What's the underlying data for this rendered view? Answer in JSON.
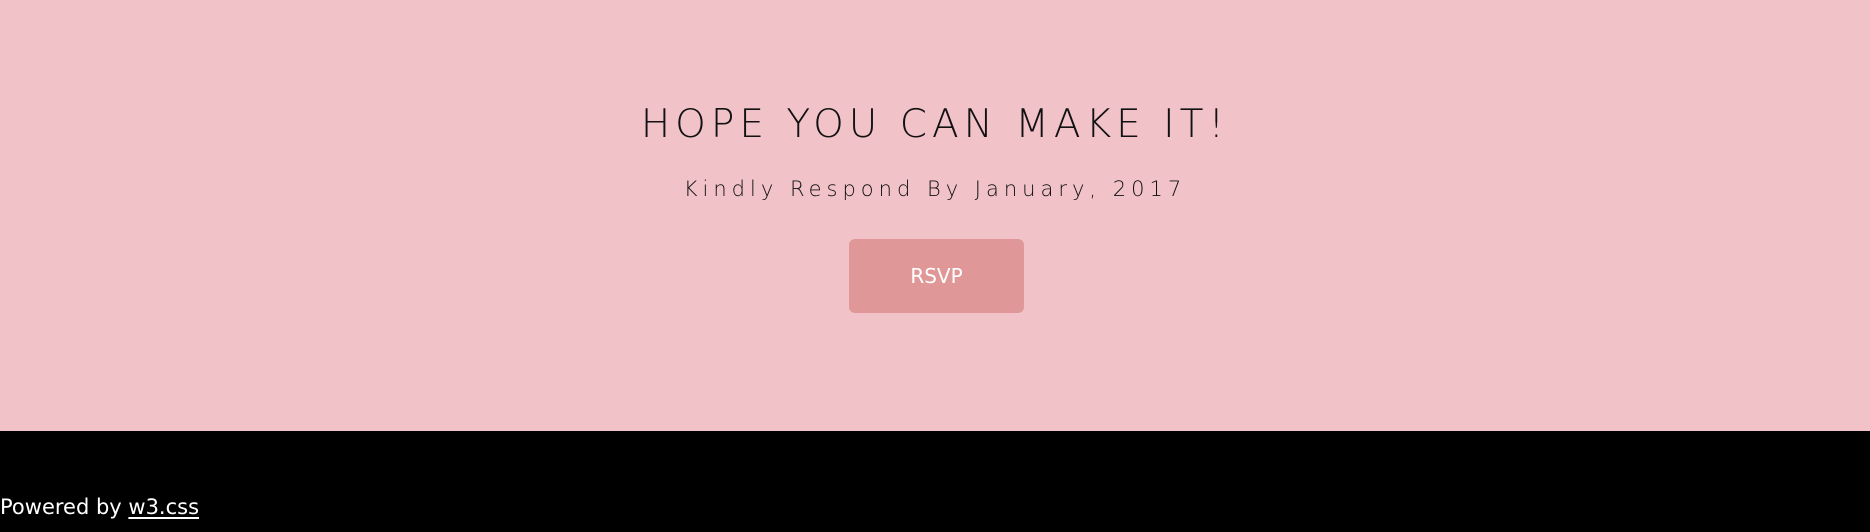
{
  "rsvp": {
    "title": "HOPE YOU CAN MAKE IT!",
    "subtitle": "Kindly Respond By January, 2017",
    "button_label": "RSVP"
  },
  "footer": {
    "prefix": "Powered by ",
    "link_label": "w3.css"
  },
  "colors": {
    "background": "#f1c3c9",
    "button": "#e09797",
    "footer": "#000000",
    "text": "#111111",
    "footer_text": "#ffffff"
  }
}
